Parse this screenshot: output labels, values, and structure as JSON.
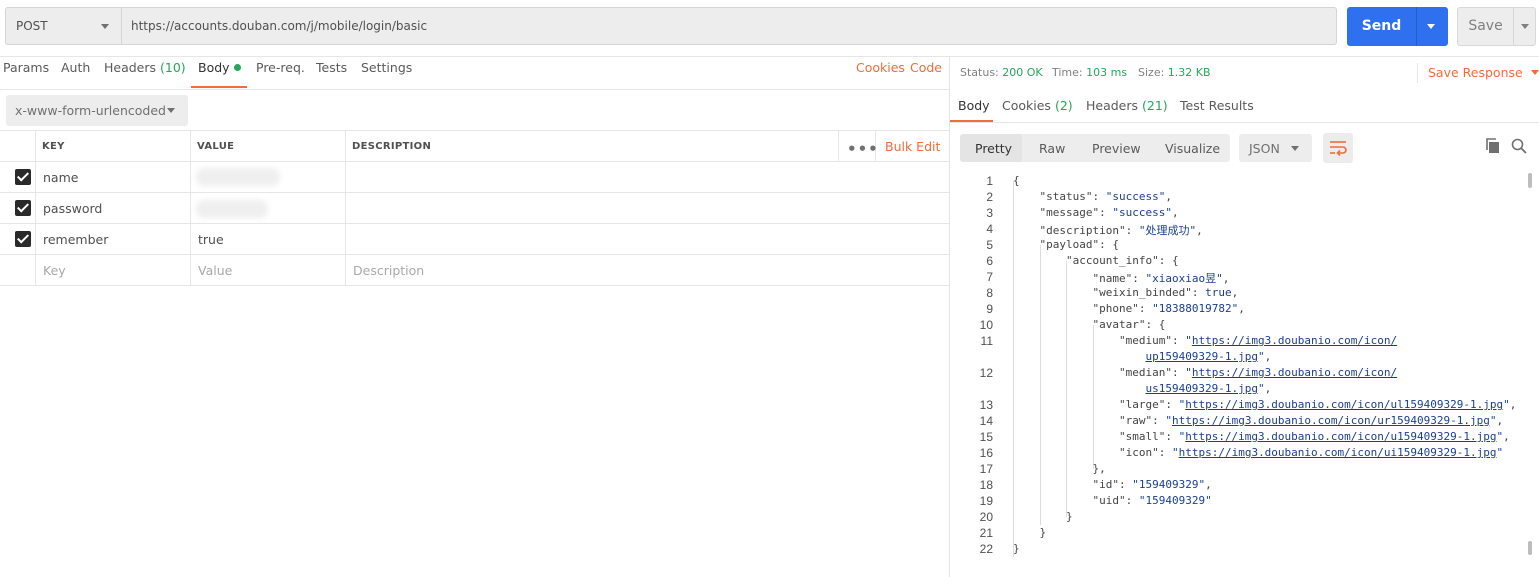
{
  "request": {
    "method": "POST",
    "url": "https://accounts.douban.com/j/mobile/login/basic",
    "send_label": "Send",
    "save_label": "Save"
  },
  "req_tabs": {
    "params": "Params",
    "auth": "Auth",
    "headers": "Headers",
    "headers_count": "(10)",
    "body": "Body",
    "prereq": "Pre-req.",
    "tests": "Tests",
    "settings": "Settings",
    "cookies": "Cookies",
    "code": "Code"
  },
  "body_type": "x-www-form-urlencoded",
  "table": {
    "headers": {
      "key": "KEY",
      "value": "VALUE",
      "description": "DESCRIPTION"
    },
    "bulk_edit": "Bulk Edit",
    "rows": [
      {
        "key": "name",
        "value": "",
        "checked": true
      },
      {
        "key": "password",
        "value": "",
        "checked": true
      },
      {
        "key": "remember",
        "value": "true",
        "checked": true
      }
    ],
    "placeholder": {
      "key": "Key",
      "value": "Value",
      "description": "Description"
    }
  },
  "response": {
    "status_label": "Status:",
    "status_value": "200 OK",
    "time_label": "Time:",
    "time_value": "103 ms",
    "size_label": "Size:",
    "size_value": "1.32 KB",
    "save_response": "Save Response",
    "tabs": {
      "body": "Body",
      "cookies": "Cookies",
      "cookies_count": "(2)",
      "headers": "Headers",
      "headers_count": "(21)",
      "test_results": "Test Results"
    },
    "formats": [
      "Pretty",
      "Raw",
      "Preview",
      "Visualize"
    ],
    "language": "JSON"
  },
  "json_lines": [
    {
      "n": "1",
      "html": "<span class=\"k\">{</span>"
    },
    {
      "n": "2",
      "html": "    <span class=\"k\">\"status\"</span>: <span class=\"s\">\"success\"</span>,"
    },
    {
      "n": "3",
      "html": "    <span class=\"k\">\"message\"</span>: <span class=\"s\">\"success\"</span>,"
    },
    {
      "n": "4",
      "html": "    <span class=\"k\">\"description\"</span>: <span class=\"s\">\"处理成功\"</span>,"
    },
    {
      "n": "5",
      "html": "    <span class=\"k\">\"payload\"</span>: {"
    },
    {
      "n": "6",
      "html": "        <span class=\"k\">\"account_info\"</span>: {"
    },
    {
      "n": "7",
      "html": "            <span class=\"k\">\"name\"</span>: <span class=\"s\">\"xiaoxiao昱\"</span>,"
    },
    {
      "n": "8",
      "html": "            <span class=\"k\">\"weixin_binded\"</span>: <span class=\"b\">true</span>,"
    },
    {
      "n": "9",
      "html": "            <span class=\"k\">\"phone\"</span>: <span class=\"s\">\"18388019782\"</span>,"
    },
    {
      "n": "10",
      "html": "            <span class=\"k\">\"avatar\"</span>: {"
    },
    {
      "n": "11",
      "html": "                <span class=\"k\">\"medium\"</span>: <span class=\"s\">\"</span><span class=\"u\">https://img3.doubanio.com/icon/</span>"
    },
    {
      "n": "",
      "html": "                    <span class=\"u\">up159409329-1.jpg</span><span class=\"s\">\"</span>,"
    },
    {
      "n": "12",
      "html": "                <span class=\"k\">\"median\"</span>: <span class=\"s\">\"</span><span class=\"u\">https://img3.doubanio.com/icon/</span>"
    },
    {
      "n": "",
      "html": "                    <span class=\"u\">us159409329-1.jpg</span><span class=\"s\">\"</span>,"
    },
    {
      "n": "13",
      "html": "                <span class=\"k\">\"large\"</span>: <span class=\"s\">\"</span><span class=\"u\">https://img3.doubanio.com/icon/ul159409329-1.jpg</span><span class=\"s\">\"</span>,"
    },
    {
      "n": "14",
      "html": "                <span class=\"k\">\"raw\"</span>: <span class=\"s\">\"</span><span class=\"u\">https://img3.doubanio.com/icon/ur159409329-1.jpg</span><span class=\"s\">\"</span>,"
    },
    {
      "n": "15",
      "html": "                <span class=\"k\">\"small\"</span>: <span class=\"s\">\"</span><span class=\"u\">https://img3.doubanio.com/icon/u159409329-1.jpg</span><span class=\"s\">\"</span>,"
    },
    {
      "n": "16",
      "html": "                <span class=\"k\">\"icon\"</span>: <span class=\"s\">\"</span><span class=\"u\">https://img3.doubanio.com/icon/ui159409329-1.jpg</span><span class=\"s\">\"</span>"
    },
    {
      "n": "17",
      "html": "            },"
    },
    {
      "n": "18",
      "html": "            <span class=\"k\">\"id\"</span>: <span class=\"s\">\"159409329\"</span>,"
    },
    {
      "n": "19",
      "html": "            <span class=\"k\">\"uid\"</span>: <span class=\"s\">\"159409329\"</span>"
    },
    {
      "n": "20",
      "html": "        }"
    },
    {
      "n": "21",
      "html": "    }"
    },
    {
      "n": "22",
      "html": "<span class=\"k\">}</span>"
    }
  ],
  "colors": {
    "accent": "#f26b3a",
    "send": "#2f70ee",
    "success": "#26a65b",
    "json_string": "#1a3f92"
  }
}
